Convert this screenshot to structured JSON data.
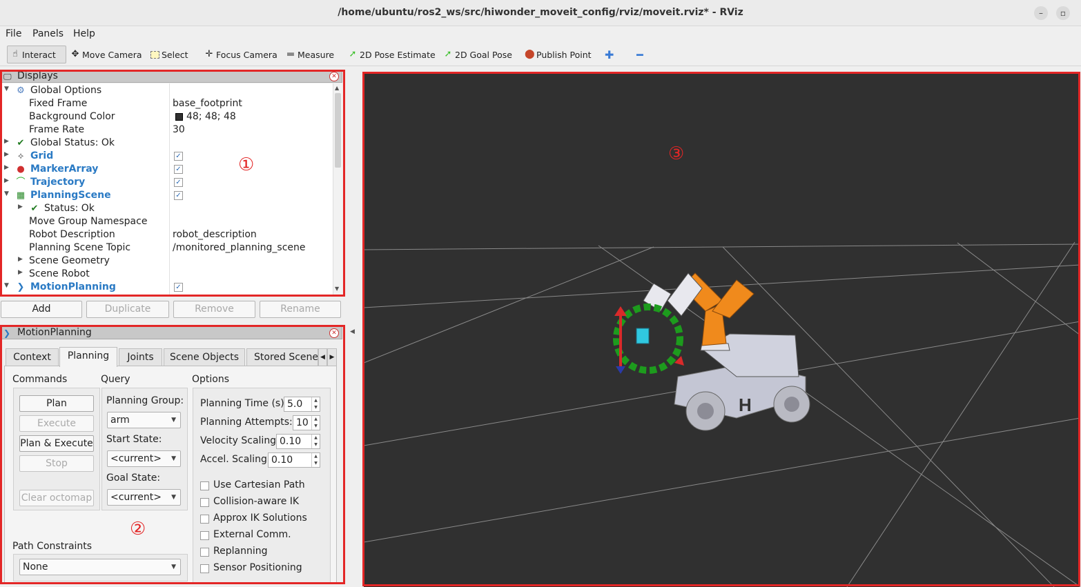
{
  "window": {
    "title": "/home/ubuntu/ros2_ws/src/hiwonder_moveit_config/rviz/moveit.rviz* - RViz"
  },
  "menu": [
    "File",
    "Panels",
    "Help"
  ],
  "toolbar": {
    "interact": "Interact",
    "move_camera": "Move Camera",
    "select": "Select",
    "focus_camera": "Focus Camera",
    "measure": "Measure",
    "pose_estimate": "2D Pose Estimate",
    "goal_pose": "2D Goal Pose",
    "publish_point": "Publish Point"
  },
  "displays": {
    "title": "Displays",
    "rows": [
      {
        "label": "Global Options",
        "value": ""
      },
      {
        "label": "Fixed Frame",
        "value": "base_footprint"
      },
      {
        "label": "Background Color",
        "value": "48; 48; 48"
      },
      {
        "label": "Frame Rate",
        "value": "30"
      },
      {
        "label": "Global Status: Ok",
        "value": ""
      },
      {
        "label": "Grid",
        "checked": true
      },
      {
        "label": "MarkerArray",
        "checked": true
      },
      {
        "label": "Trajectory",
        "checked": true
      },
      {
        "label": "PlanningScene",
        "checked": true
      },
      {
        "label": "Status: Ok",
        "value": ""
      },
      {
        "label": "Move Group Namespace",
        "value": ""
      },
      {
        "label": "Robot Description",
        "value": "robot_description"
      },
      {
        "label": "Planning Scene Topic",
        "value": "/monitored_planning_scene"
      },
      {
        "label": "Scene Geometry",
        "value": ""
      },
      {
        "label": "Scene Robot",
        "value": ""
      },
      {
        "label": "MotionPlanning",
        "checked": true
      }
    ],
    "buttons": {
      "add": "Add",
      "duplicate": "Duplicate",
      "remove": "Remove",
      "rename": "Rename"
    }
  },
  "motion_planning": {
    "title": "MotionPlanning",
    "tabs": [
      "Context",
      "Planning",
      "Joints",
      "Scene Objects",
      "Stored Scene"
    ],
    "active_tab": "Planning",
    "commands": {
      "heading": "Commands",
      "plan": "Plan",
      "execute": "Execute",
      "plan_execute": "Plan & Execute",
      "stop": "Stop",
      "clear_octomap": "Clear octomap"
    },
    "query": {
      "heading": "Query",
      "planning_group_label": "Planning Group:",
      "planning_group": "arm",
      "start_state_label": "Start State:",
      "start_state": "<current>",
      "goal_state_label": "Goal State:",
      "goal_state": "<current>"
    },
    "options": {
      "heading": "Options",
      "planning_time_label": "Planning Time (s):",
      "planning_time": "5.0",
      "planning_attempts_label": "Planning Attempts:",
      "planning_attempts": "10",
      "velocity_scaling_label": "Velocity Scaling:",
      "velocity_scaling": "0.10",
      "accel_scaling_label": "Accel. Scaling:",
      "accel_scaling": "0.10",
      "checkboxes": [
        "Use Cartesian Path",
        "Collision-aware IK",
        "Approx IK Solutions",
        "External Comm.",
        "Replanning",
        "Sensor Positioning"
      ]
    },
    "path_constraints": {
      "label": "Path Constraints",
      "value": "None"
    }
  },
  "annotations": {
    "one": "①",
    "two": "②",
    "three": "③"
  },
  "robot_label": "H"
}
